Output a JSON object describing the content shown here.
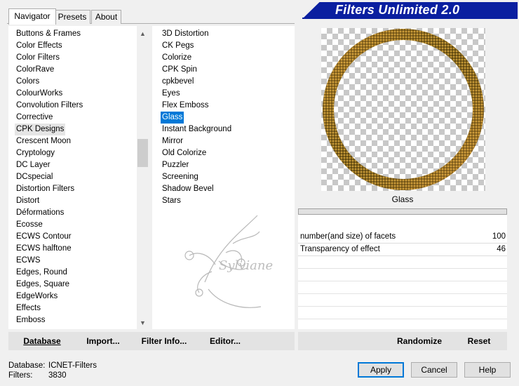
{
  "banner": {
    "title": "Filters Unlimited 2.0"
  },
  "tabs": [
    {
      "label": "Navigator"
    },
    {
      "label": "Presets"
    },
    {
      "label": "About"
    }
  ],
  "categories": [
    "Buttons & Frames",
    "Color Effects",
    "Color Filters",
    "ColorRave",
    "Colors",
    "ColourWorks",
    "Convolution Filters",
    "Corrective",
    "CPK Designs",
    "Crescent Moon",
    "Cryptology",
    "DC Layer",
    "DCspecial",
    "Distortion Filters",
    "Distort",
    "Déformations",
    "Ecosse",
    "ECWS Contour",
    "ECWS halftone",
    "ECWS",
    "Edges, Round",
    "Edges, Square",
    "EdgeWorks",
    "Effects",
    "Emboss"
  ],
  "selected_category": "CPK Designs",
  "filters": [
    "3D Distortion",
    "CK Pegs",
    "Colorize",
    "CPK Spin",
    "cpkbevel",
    "Eyes",
    "Flex Emboss",
    "Glass",
    "Instant Background",
    "Mirror",
    "Old Colorize",
    "Puzzler",
    "Screening",
    "Shadow Bevel",
    "Stars"
  ],
  "selected_filter": "Glass",
  "watermark": {
    "text": "Sylviane"
  },
  "preview": {
    "filter_name": "Glass"
  },
  "params": [
    {
      "label": "number(and size) of facets",
      "value": "100"
    },
    {
      "label": "Transparency of effect",
      "value": "46"
    }
  ],
  "toolbar": {
    "database": "Database",
    "import": "Import...",
    "filter_info": "Filter Info...",
    "editor": "Editor...",
    "randomize": "Randomize",
    "reset": "Reset"
  },
  "status": {
    "database_label": "Database:",
    "database_value": "ICNET-Filters",
    "filters_label": "Filters:",
    "filters_value": "3830"
  },
  "buttons": {
    "apply": "Apply",
    "cancel": "Cancel",
    "help": "Help"
  },
  "colors": {
    "banner": "#0a1fa0",
    "selection": "#0078d7",
    "ring_gold": "#c08a2a"
  }
}
